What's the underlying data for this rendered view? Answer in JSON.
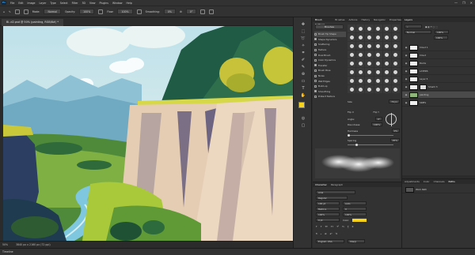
{
  "app": {
    "logo": "Ps",
    "menu": [
      "File",
      "Edit",
      "Image",
      "Layer",
      "Type",
      "Select",
      "Filter",
      "3D",
      "View",
      "Plugins",
      "Window",
      "Help"
    ],
    "window_controls": [
      "—",
      "❐",
      "✕"
    ]
  },
  "options": {
    "mode_label": "Mode:",
    "mode_value": "Normal",
    "opacity_label": "Opacity:",
    "opacity_value": "100%",
    "flow_label": "Flow:",
    "flow_value": "100%",
    "smoothing_label": "Smoothing:",
    "smoothing_value": "0%",
    "angle_value": "0°"
  },
  "document": {
    "tab_title": "Bl..d2.psd @ 50% (painting, RGB/8#) *"
  },
  "status": {
    "zoom": "50%",
    "size": "3840 px x 2160 px (72 ppi)"
  },
  "timeline": {
    "label": "Timeline"
  },
  "brush_settings": {
    "tabs": [
      "Brush Settings",
      "Brushes",
      "Actions",
      "History",
      "Navigator",
      "Properties"
    ],
    "brushes_button": "Brushes",
    "options": [
      {
        "label": "Brush Tip Shape",
        "checked": false,
        "selected": true
      },
      {
        "label": "Shape Dynamics",
        "checked": true,
        "selected": false
      },
      {
        "label": "Scattering",
        "checked": false,
        "selected": false
      },
      {
        "label": "Texture",
        "checked": false,
        "selected": false
      },
      {
        "label": "Dual Brush",
        "checked": false,
        "selected": false
      },
      {
        "label": "Color Dynamics",
        "checked": false,
        "selected": false
      },
      {
        "label": "Transfer",
        "checked": true,
        "selected": false
      },
      {
        "label": "Brush Pose",
        "checked": false,
        "selected": false
      },
      {
        "label": "Noise",
        "checked": false,
        "selected": false
      },
      {
        "label": "Wet Edges",
        "checked": false,
        "selected": false
      },
      {
        "label": "Build-up",
        "checked": false,
        "selected": false
      },
      {
        "label": "Smoothing",
        "checked": true,
        "selected": false
      },
      {
        "label": "Protect Texture",
        "checked": false,
        "selected": false
      }
    ],
    "size_label": "Size",
    "size_value": "70 px",
    "flip_x": "Flip X",
    "flip_y": "Flip Y",
    "angle_label": "Angle:",
    "angle_value": "0°",
    "roundness_label": "Roundness:",
    "roundness_value": "100%",
    "hardness_label": "Hardness",
    "hardness_value": "0%",
    "spacing_label": "Spacing",
    "spacing_value": "25%"
  },
  "character": {
    "tabs": [
      "Character",
      "Paragraph"
    ],
    "font": "Arial",
    "style": "Regular",
    "size": "100 pt",
    "leading": "Auto",
    "tracking": "Metrics",
    "kerning": "0",
    "scale_v": "100%",
    "scale_h": "100%",
    "baseline": "0 pt",
    "color_label": "Color:",
    "language": "English: USA",
    "aa": "Sharp"
  },
  "layers": {
    "tab": "Layers",
    "blend": "Normal",
    "opacity": "100%",
    "fill": "100%",
    "items": [
      {
        "name": "Cloud 1",
        "selected": false
      },
      {
        "name": "Cloud",
        "selected": false
      },
      {
        "name": "Rocks",
        "selected": false
      },
      {
        "name": "LAYERS",
        "selected": false
      },
      {
        "name": "Layer 5",
        "selected": false
      },
      {
        "name": "Smallr 3",
        "selected": false
      },
      {
        "name": "painting",
        "selected": true
      },
      {
        "name": "SKIES",
        "selected": false
      }
    ]
  },
  "paths": {
    "tabs": [
      "Adjustments",
      "Color",
      "Channels",
      "Paths"
    ],
    "item": "Work Path"
  },
  "colors": {
    "foreground": "#f7d31b",
    "background": "#ffffff"
  }
}
